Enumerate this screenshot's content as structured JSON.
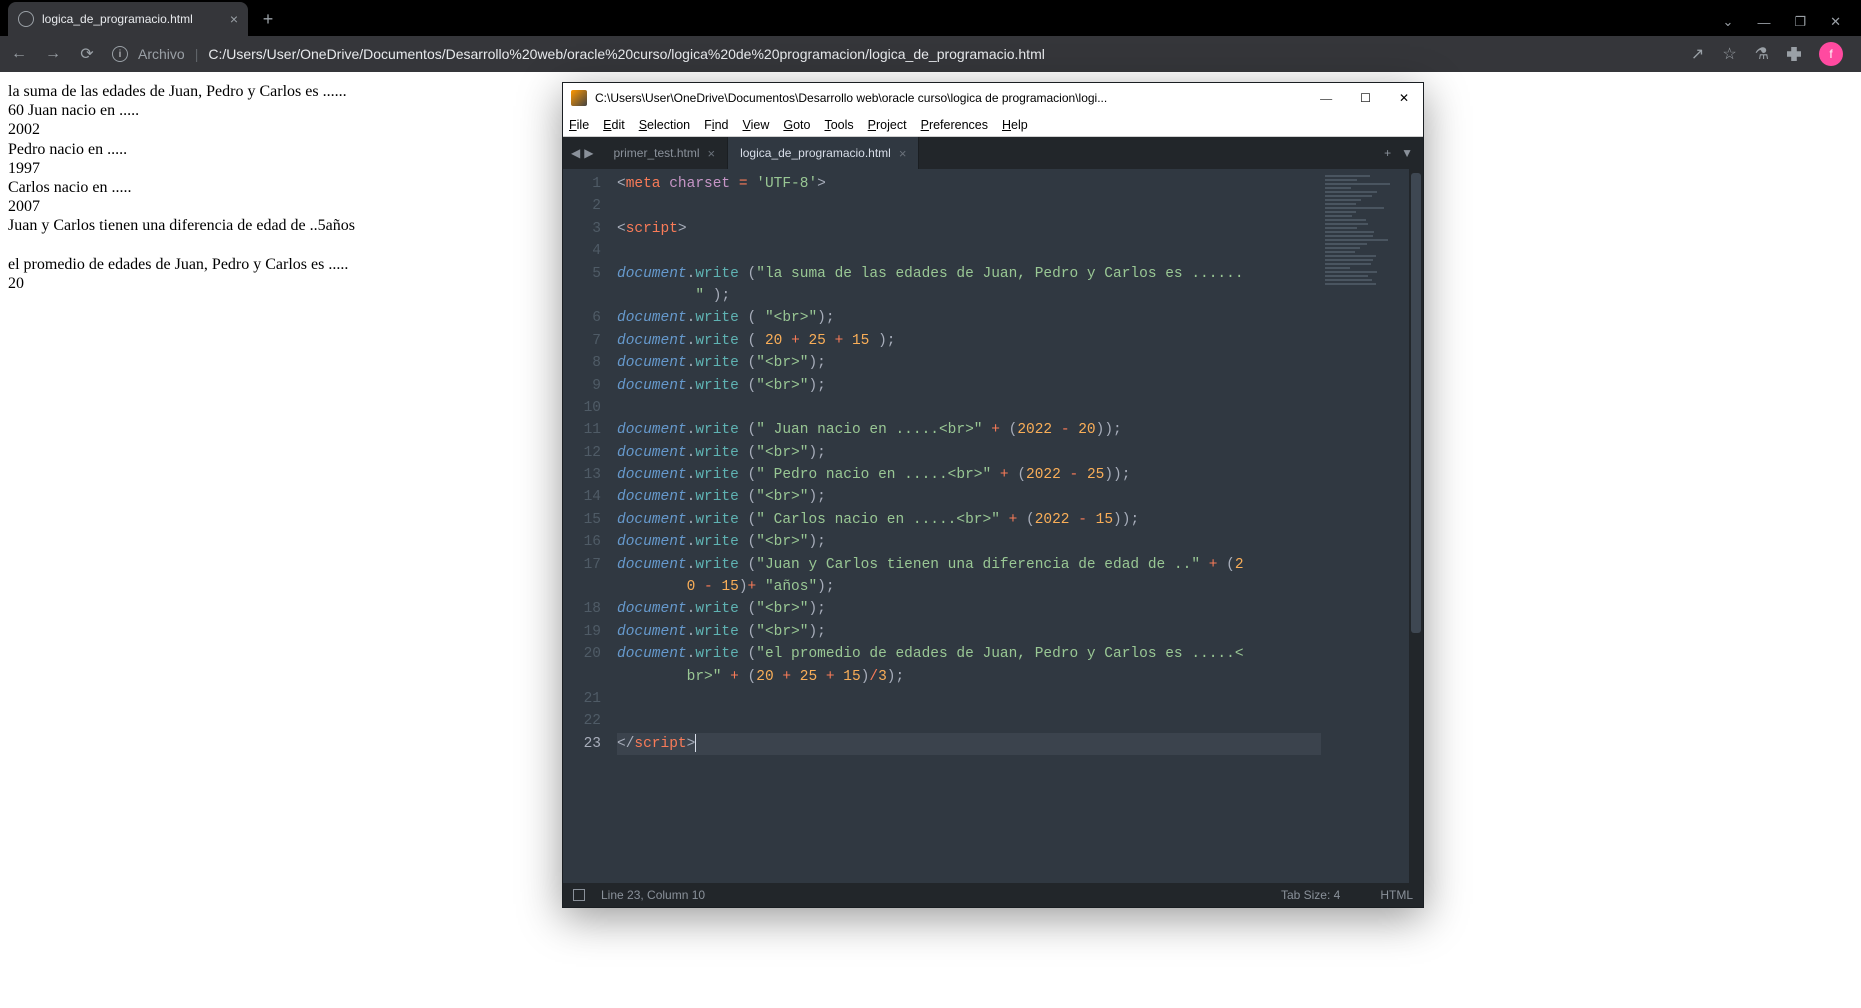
{
  "browser": {
    "tab_title": "logica_de_programacio.html",
    "address_prefix": "Archivo",
    "address_path": "C:/Users/User/OneDrive/Documentos/Desarrollo%20web/oracle%20curso/logica%20de%20programacion/logica_de_programacio.html",
    "avatar_letter": "f"
  },
  "page_output": {
    "lines": [
      "la suma de las edades de Juan, Pedro y Carlos es ......",
      "60 Juan nacio en .....",
      "2002",
      "Pedro nacio en .....",
      "1997",
      "Carlos nacio en .....",
      "2007",
      "Juan y Carlos tienen una diferencia de edad de ..5años",
      "",
      "el promedio de edades de Juan, Pedro y Carlos es .....",
      "20"
    ]
  },
  "sublime": {
    "title": "C:\\Users\\User\\OneDrive\\Documentos\\Desarrollo web\\oracle curso\\logica de programacion\\logi...",
    "menu": [
      "File",
      "Edit",
      "Selection",
      "Find",
      "View",
      "Goto",
      "Tools",
      "Project",
      "Preferences",
      "Help"
    ],
    "tabs": [
      {
        "name": "primer_test.html",
        "active": false
      },
      {
        "name": "logica_de_programacio.html",
        "active": true
      }
    ],
    "status": {
      "pos": "Line 23, Column 10",
      "tabsize": "Tab Size: 4",
      "lang": "HTML"
    },
    "code_tokens": [
      [
        [
          "punc",
          "<"
        ],
        [
          "tag",
          "meta"
        ],
        [
          "plain",
          " "
        ],
        [
          "attr",
          "charset"
        ],
        [
          "plain",
          " "
        ],
        [
          "op",
          "="
        ],
        [
          "plain",
          " "
        ],
        [
          "str",
          "'UTF-8'"
        ],
        [
          "punc",
          ">"
        ]
      ],
      [],
      [
        [
          "punc",
          "<"
        ],
        [
          "tag",
          "script"
        ],
        [
          "punc",
          ">"
        ]
      ],
      [],
      [
        [
          "obj",
          "document"
        ],
        [
          "punc",
          "."
        ],
        [
          "func",
          "write"
        ],
        [
          "plain",
          " "
        ],
        [
          "punc",
          "("
        ],
        [
          "str",
          "\"la suma de las edades de Juan, Pedro y Carlos es ...... \""
        ],
        [
          "plain",
          " "
        ],
        [
          "punc",
          ")"
        ],
        [
          "punc",
          ";"
        ]
      ],
      [
        [
          "obj",
          "document"
        ],
        [
          "punc",
          "."
        ],
        [
          "func",
          "write"
        ],
        [
          "plain",
          " "
        ],
        [
          "punc",
          "("
        ],
        [
          "plain",
          " "
        ],
        [
          "str",
          "\"<br>\""
        ],
        [
          "punc",
          ")"
        ],
        [
          "punc",
          ";"
        ]
      ],
      [
        [
          "obj",
          "document"
        ],
        [
          "punc",
          "."
        ],
        [
          "func",
          "write"
        ],
        [
          "plain",
          " "
        ],
        [
          "punc",
          "("
        ],
        [
          "plain",
          " "
        ],
        [
          "num",
          "20"
        ],
        [
          "plain",
          " "
        ],
        [
          "op",
          "+"
        ],
        [
          "plain",
          " "
        ],
        [
          "num",
          "25"
        ],
        [
          "plain",
          " "
        ],
        [
          "op",
          "+"
        ],
        [
          "plain",
          " "
        ],
        [
          "num",
          "15"
        ],
        [
          "plain",
          " "
        ],
        [
          "punc",
          ")"
        ],
        [
          "punc",
          ";"
        ]
      ],
      [
        [
          "obj",
          "document"
        ],
        [
          "punc",
          "."
        ],
        [
          "func",
          "write"
        ],
        [
          "plain",
          " "
        ],
        [
          "punc",
          "("
        ],
        [
          "str",
          "\"<br>\""
        ],
        [
          "punc",
          ")"
        ],
        [
          "punc",
          ";"
        ]
      ],
      [
        [
          "obj",
          "document"
        ],
        [
          "punc",
          "."
        ],
        [
          "func",
          "write"
        ],
        [
          "plain",
          " "
        ],
        [
          "punc",
          "("
        ],
        [
          "str",
          "\"<br>\""
        ],
        [
          "punc",
          ")"
        ],
        [
          "punc",
          ";"
        ]
      ],
      [],
      [
        [
          "obj",
          "document"
        ],
        [
          "punc",
          "."
        ],
        [
          "func",
          "write"
        ],
        [
          "plain",
          " "
        ],
        [
          "punc",
          "("
        ],
        [
          "str",
          "\" Juan nacio en .....<br>\""
        ],
        [
          "plain",
          " "
        ],
        [
          "op",
          "+"
        ],
        [
          "plain",
          " "
        ],
        [
          "punc",
          "("
        ],
        [
          "num",
          "2022"
        ],
        [
          "plain",
          " "
        ],
        [
          "op",
          "-"
        ],
        [
          "plain",
          " "
        ],
        [
          "num",
          "20"
        ],
        [
          "punc",
          ")"
        ],
        [
          "punc",
          ")"
        ],
        [
          "punc",
          ";"
        ]
      ],
      [
        [
          "obj",
          "document"
        ],
        [
          "punc",
          "."
        ],
        [
          "func",
          "write"
        ],
        [
          "plain",
          " "
        ],
        [
          "punc",
          "("
        ],
        [
          "str",
          "\"<br>\""
        ],
        [
          "punc",
          ")"
        ],
        [
          "punc",
          ";"
        ]
      ],
      [
        [
          "obj",
          "document"
        ],
        [
          "punc",
          "."
        ],
        [
          "func",
          "write"
        ],
        [
          "plain",
          " "
        ],
        [
          "punc",
          "("
        ],
        [
          "str",
          "\" Pedro nacio en .....<br>\""
        ],
        [
          "plain",
          " "
        ],
        [
          "op",
          "+"
        ],
        [
          "plain",
          " "
        ],
        [
          "punc",
          "("
        ],
        [
          "num",
          "2022"
        ],
        [
          "plain",
          " "
        ],
        [
          "op",
          "-"
        ],
        [
          "plain",
          " "
        ],
        [
          "num",
          "25"
        ],
        [
          "punc",
          ")"
        ],
        [
          "punc",
          ")"
        ],
        [
          "punc",
          ";"
        ]
      ],
      [
        [
          "obj",
          "document"
        ],
        [
          "punc",
          "."
        ],
        [
          "func",
          "write"
        ],
        [
          "plain",
          " "
        ],
        [
          "punc",
          "("
        ],
        [
          "str",
          "\"<br>\""
        ],
        [
          "punc",
          ")"
        ],
        [
          "punc",
          ";"
        ]
      ],
      [
        [
          "obj",
          "document"
        ],
        [
          "punc",
          "."
        ],
        [
          "func",
          "write"
        ],
        [
          "plain",
          " "
        ],
        [
          "punc",
          "("
        ],
        [
          "str",
          "\" Carlos nacio en .....<br>\""
        ],
        [
          "plain",
          " "
        ],
        [
          "op",
          "+"
        ],
        [
          "plain",
          " "
        ],
        [
          "punc",
          "("
        ],
        [
          "num",
          "2022"
        ],
        [
          "plain",
          " "
        ],
        [
          "op",
          "-"
        ],
        [
          "plain",
          " "
        ],
        [
          "num",
          "15"
        ],
        [
          "punc",
          ")"
        ],
        [
          "punc",
          ")"
        ],
        [
          "punc",
          ";"
        ]
      ],
      [
        [
          "obj",
          "document"
        ],
        [
          "punc",
          "."
        ],
        [
          "func",
          "write"
        ],
        [
          "plain",
          " "
        ],
        [
          "punc",
          "("
        ],
        [
          "str",
          "\"<br>\""
        ],
        [
          "punc",
          ")"
        ],
        [
          "punc",
          ";"
        ]
      ],
      [
        [
          "obj",
          "document"
        ],
        [
          "punc",
          "."
        ],
        [
          "func",
          "write"
        ],
        [
          "plain",
          " "
        ],
        [
          "punc",
          "("
        ],
        [
          "str",
          "\"Juan y Carlos tienen una diferencia de edad de ..\""
        ],
        [
          "plain",
          " "
        ],
        [
          "op",
          "+"
        ],
        [
          "plain",
          " "
        ],
        [
          "punc",
          "("
        ],
        [
          "num",
          "20"
        ],
        [
          "plain",
          " "
        ],
        [
          "op",
          "-"
        ],
        [
          "plain",
          " "
        ],
        [
          "num",
          "15"
        ],
        [
          "punc",
          ")"
        ],
        [
          "op",
          "+"
        ],
        [
          "plain",
          " "
        ],
        [
          "str",
          "\"años\""
        ],
        [
          "punc",
          ")"
        ],
        [
          "punc",
          ";"
        ]
      ],
      [
        [
          "obj",
          "document"
        ],
        [
          "punc",
          "."
        ],
        [
          "func",
          "write"
        ],
        [
          "plain",
          " "
        ],
        [
          "punc",
          "("
        ],
        [
          "str",
          "\"<br>\""
        ],
        [
          "punc",
          ")"
        ],
        [
          "punc",
          ";"
        ]
      ],
      [
        [
          "obj",
          "document"
        ],
        [
          "punc",
          "."
        ],
        [
          "func",
          "write"
        ],
        [
          "plain",
          " "
        ],
        [
          "punc",
          "("
        ],
        [
          "str",
          "\"<br>\""
        ],
        [
          "punc",
          ")"
        ],
        [
          "punc",
          ";"
        ]
      ],
      [
        [
          "obj",
          "document"
        ],
        [
          "punc",
          "."
        ],
        [
          "func",
          "write"
        ],
        [
          "plain",
          " "
        ],
        [
          "punc",
          "("
        ],
        [
          "str",
          "\"el promedio de edades de Juan, Pedro y Carlos es .....<br>\""
        ],
        [
          "plain",
          " "
        ],
        [
          "op",
          "+"
        ],
        [
          "plain",
          " "
        ],
        [
          "punc",
          "("
        ],
        [
          "num",
          "20"
        ],
        [
          "plain",
          " "
        ],
        [
          "op",
          "+"
        ],
        [
          "plain",
          " "
        ],
        [
          "num",
          "25"
        ],
        [
          "plain",
          " "
        ],
        [
          "op",
          "+"
        ],
        [
          "plain",
          " "
        ],
        [
          "num",
          "15"
        ],
        [
          "punc",
          ")"
        ],
        [
          "op",
          "/"
        ],
        [
          "num",
          "3"
        ],
        [
          "punc",
          ")"
        ],
        [
          "punc",
          ";"
        ]
      ],
      [],
      [],
      [
        [
          "punc",
          "</"
        ],
        [
          "tag",
          "script"
        ],
        [
          "punc",
          ">"
        ],
        [
          "cursor",
          ""
        ]
      ]
    ],
    "line_numbers": [
      "1",
      "2",
      "3",
      "4",
      "5",
      "6",
      "7",
      "8",
      "9",
      "10",
      "11",
      "12",
      "13",
      "14",
      "15",
      "16",
      "17",
      "18",
      "19",
      "20",
      "21",
      "22",
      "23"
    ],
    "current_line_index": 22,
    "wrap_indent": "        "
  }
}
